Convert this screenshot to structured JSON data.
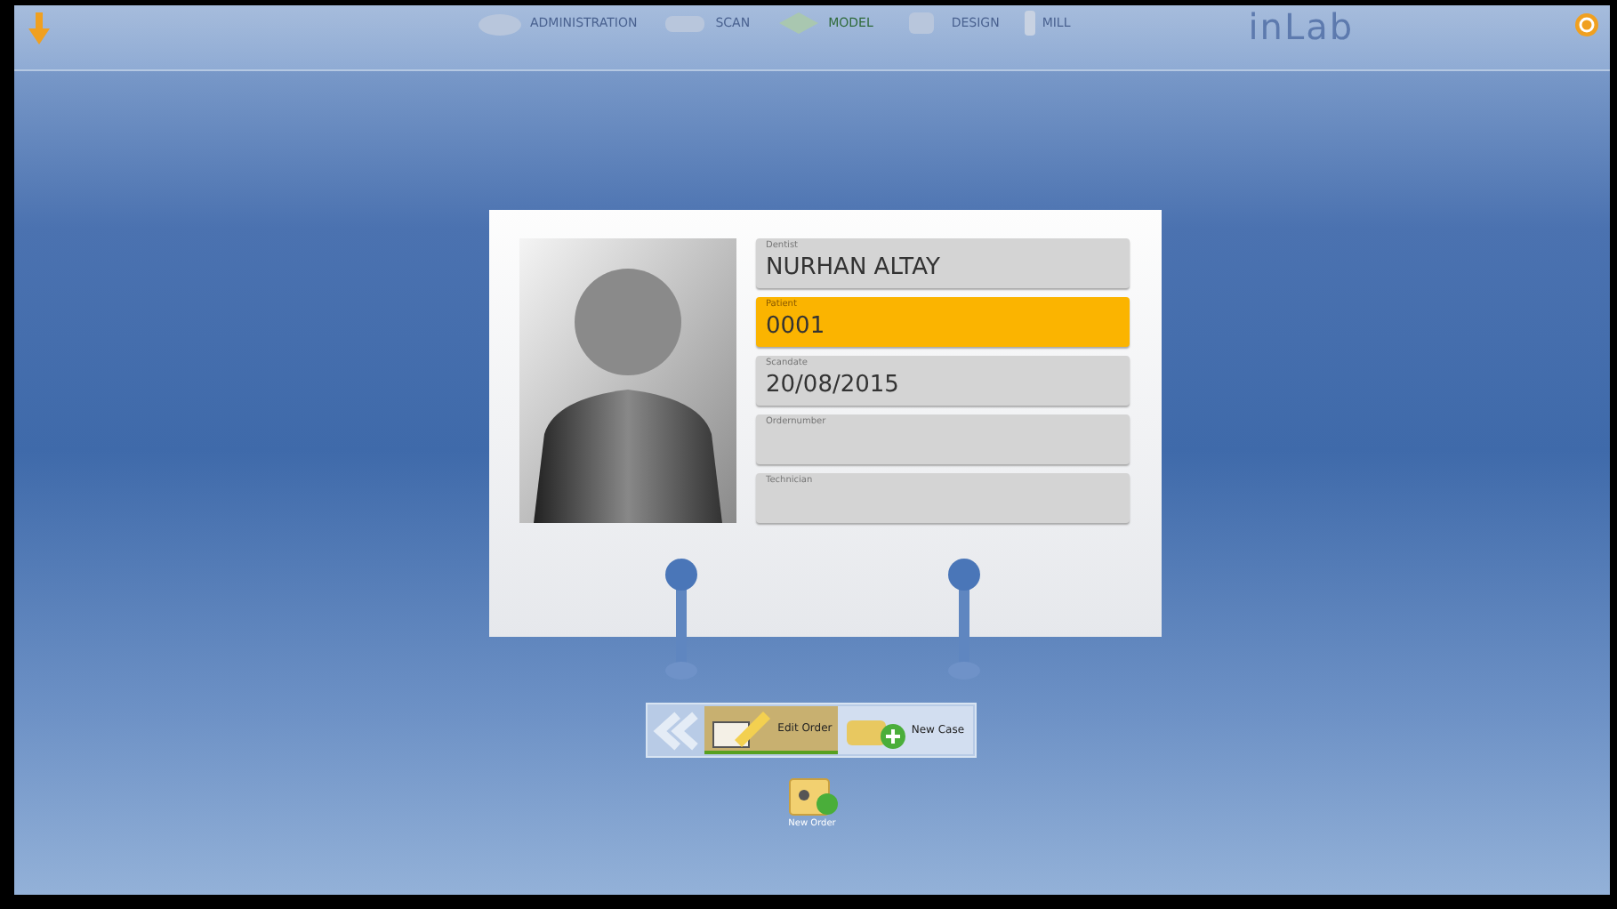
{
  "nav": [
    {
      "label": "ADMINISTRATION",
      "selected": false
    },
    {
      "label": "SCAN",
      "selected": false
    },
    {
      "label": "MODEL",
      "selected": true
    },
    {
      "label": "DESIGN",
      "selected": false
    },
    {
      "label": "MILL",
      "selected": false
    }
  ],
  "logo": "inLab",
  "fields": [
    {
      "label": "Dentist",
      "value": "NURHAN ALTAY",
      "selected": false
    },
    {
      "label": "Patient",
      "value": "0001",
      "selected": true
    },
    {
      "label": "Scandate",
      "value": "20/08/2015",
      "selected": false
    },
    {
      "label": "Ordernumber",
      "selected": false
    },
    {
      "label": "Technician",
      "selected": false
    }
  ],
  "actions": [
    {
      "label": "Edit Order",
      "selected": true
    },
    {
      "label": "New Case",
      "selected": false
    }
  ],
  "bottom": {
    "label": "New Order"
  }
}
